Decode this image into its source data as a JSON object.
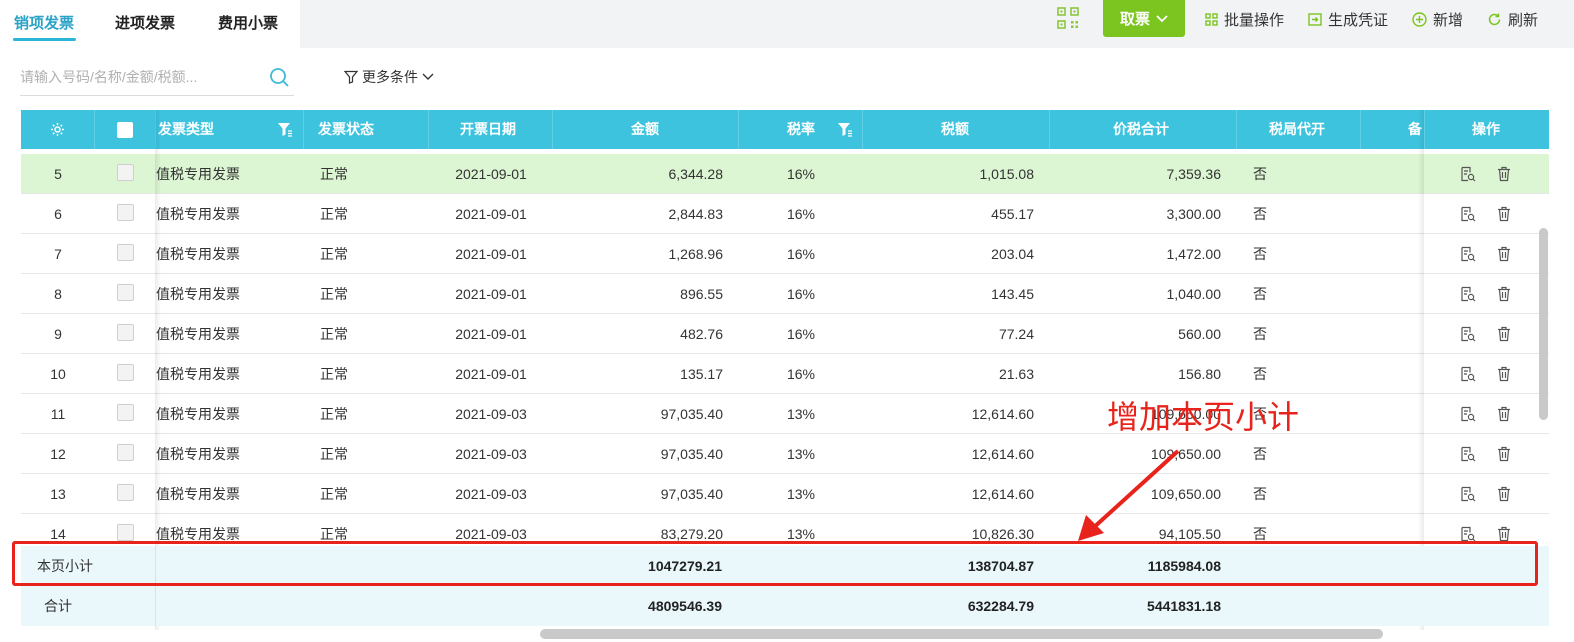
{
  "tabs": [
    {
      "label": "销项发票",
      "active": true
    },
    {
      "label": "进项发票",
      "active": false
    },
    {
      "label": "费用小票",
      "active": false
    }
  ],
  "toolbar": {
    "take_label": "取票",
    "batch_label": "批量操作",
    "voucher_label": "生成凭证",
    "add_label": "新增",
    "refresh_label": "刷新"
  },
  "search": {
    "placeholder": "请输入号码/名称/金额/税额...",
    "more_label": "更多条件"
  },
  "columns": {
    "type": "发票类型",
    "status": "发票状态",
    "date": "开票日期",
    "amount": "金额",
    "rate": "税率",
    "tax": "税额",
    "total": "价税合计",
    "agent": "税局代开",
    "remark": "备",
    "ops": "操作"
  },
  "rows": [
    {
      "no": "5",
      "type": "值税专用发票",
      "status": "正常",
      "date": "2021-09-01",
      "amount": "6,344.28",
      "rate": "16%",
      "tax": "1,015.08",
      "total": "7,359.36",
      "agent": "否",
      "highlight": true
    },
    {
      "no": "6",
      "type": "值税专用发票",
      "status": "正常",
      "date": "2021-09-01",
      "amount": "2,844.83",
      "rate": "16%",
      "tax": "455.17",
      "total": "3,300.00",
      "agent": "否"
    },
    {
      "no": "7",
      "type": "值税专用发票",
      "status": "正常",
      "date": "2021-09-01",
      "amount": "1,268.96",
      "rate": "16%",
      "tax": "203.04",
      "total": "1,472.00",
      "agent": "否"
    },
    {
      "no": "8",
      "type": "值税专用发票",
      "status": "正常",
      "date": "2021-09-01",
      "amount": "896.55",
      "rate": "16%",
      "tax": "143.45",
      "total": "1,040.00",
      "agent": "否"
    },
    {
      "no": "9",
      "type": "值税专用发票",
      "status": "正常",
      "date": "2021-09-01",
      "amount": "482.76",
      "rate": "16%",
      "tax": "77.24",
      "total": "560.00",
      "agent": "否"
    },
    {
      "no": "10",
      "type": "值税专用发票",
      "status": "正常",
      "date": "2021-09-01",
      "amount": "135.17",
      "rate": "16%",
      "tax": "21.63",
      "total": "156.80",
      "agent": "否"
    },
    {
      "no": "11",
      "type": "值税专用发票",
      "status": "正常",
      "date": "2021-09-03",
      "amount": "97,035.40",
      "rate": "13%",
      "tax": "12,614.60",
      "total": "109,650.00",
      "agent": "否"
    },
    {
      "no": "12",
      "type": "值税专用发票",
      "status": "正常",
      "date": "2021-09-03",
      "amount": "97,035.40",
      "rate": "13%",
      "tax": "12,614.60",
      "total": "109,650.00",
      "agent": "否"
    },
    {
      "no": "13",
      "type": "值税专用发票",
      "status": "正常",
      "date": "2021-09-03",
      "amount": "97,035.40",
      "rate": "13%",
      "tax": "12,614.60",
      "total": "109,650.00",
      "agent": "否"
    },
    {
      "no": "14",
      "type": "值税专用发票",
      "status": "正常",
      "date": "2021-09-03",
      "amount": "83,279.20",
      "rate": "13%",
      "tax": "10,826.30",
      "total": "94,105.50",
      "agent": "否"
    }
  ],
  "page_subtotal": {
    "label": "本页小计",
    "amount": "1047279.21",
    "tax": "138704.87",
    "total": "1185984.08"
  },
  "grand_total": {
    "label": "合计",
    "amount": "4809546.39",
    "tax": "632284.79",
    "total": "5441831.18"
  },
  "annotation": "增加本页小计",
  "colors": {
    "accent": "#3dc3de",
    "take_button": "#7cc41f",
    "annotation": "#e8231c",
    "highlight_row": "#dcf5d2"
  }
}
